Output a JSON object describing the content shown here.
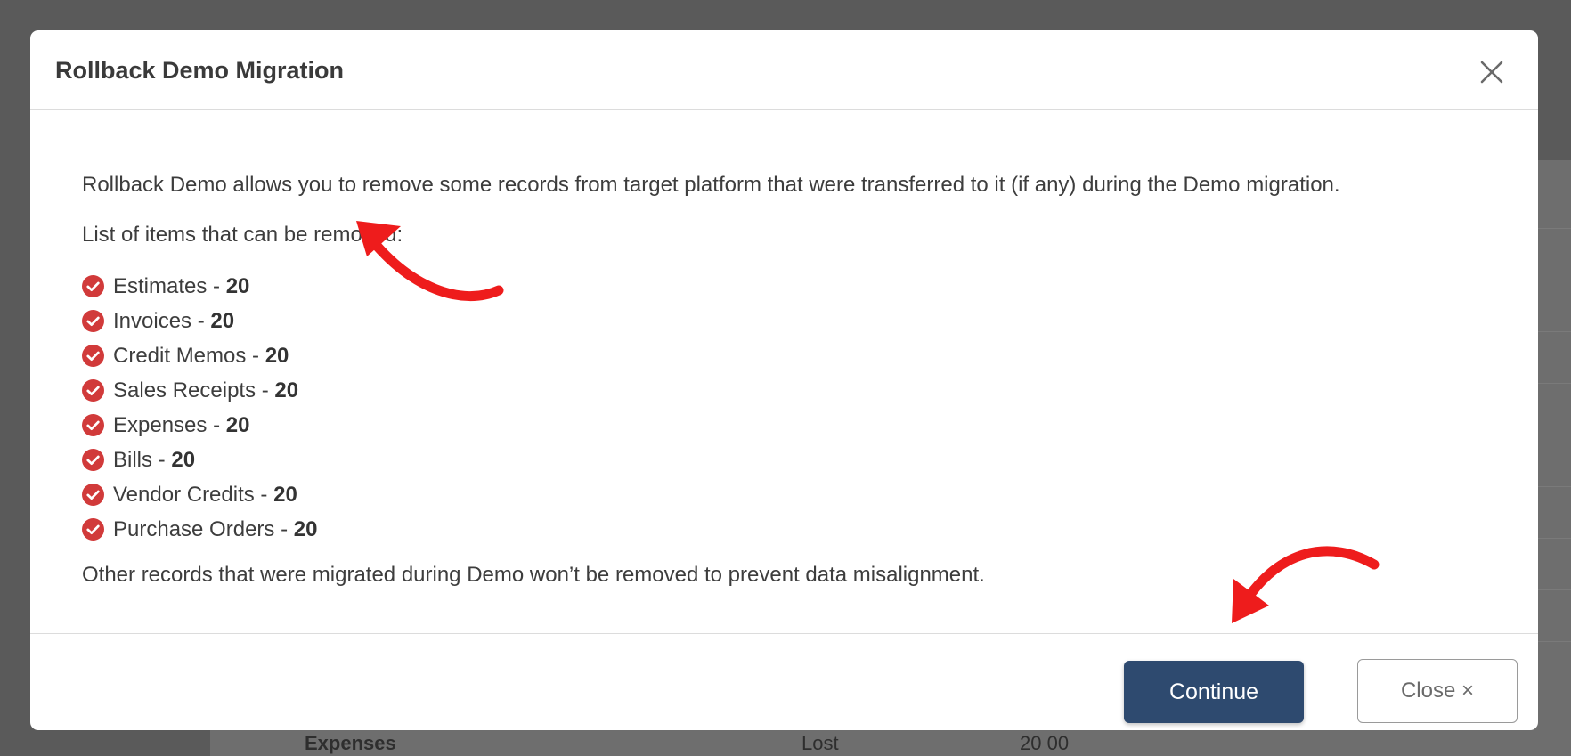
{
  "modal": {
    "title": "Rollback Demo Migration",
    "intro": "Rollback Demo allows you to remove some records from target platform that were transferred to it (if any) during the Demo migration.",
    "list_heading": "List of items that can be removed:",
    "items": [
      {
        "label": "Estimates",
        "count": "20"
      },
      {
        "label": "Invoices",
        "count": "20"
      },
      {
        "label": "Credit Memos",
        "count": "20"
      },
      {
        "label": "Sales Receipts",
        "count": "20"
      },
      {
        "label": "Expenses",
        "count": "20"
      },
      {
        "label": "Bills",
        "count": "20"
      },
      {
        "label": "Vendor Credits",
        "count": "20"
      },
      {
        "label": "Purchase Orders",
        "count": "20"
      }
    ],
    "note": "Other records that were migrated during Demo won’t be removed to prevent data misalignment.",
    "continue_label": "Continue",
    "close_label": "Close ×"
  },
  "background": {
    "row_label": "Expenses",
    "col2": "Lost",
    "col3": "20 00"
  },
  "colors": {
    "primary_button": "#2e4a6f",
    "check_icon": "#d13a3a",
    "annotation_arrow": "#ee1c1c"
  }
}
